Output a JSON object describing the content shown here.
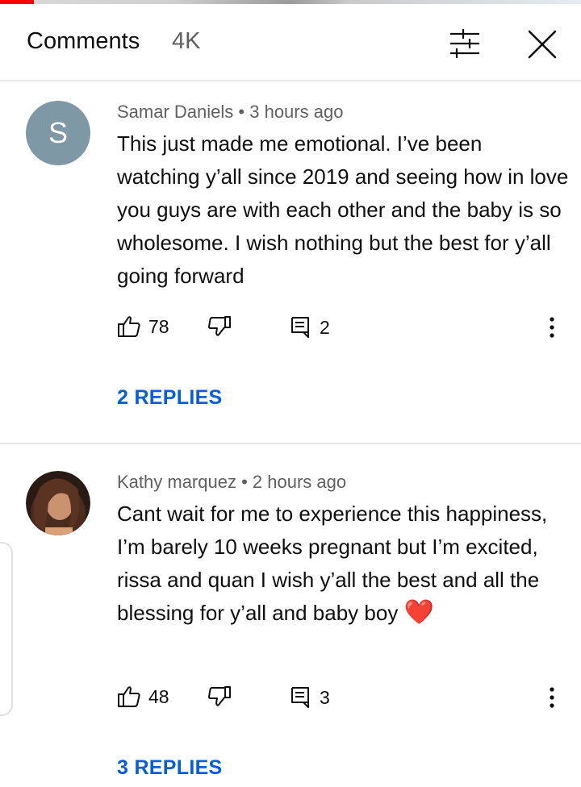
{
  "header": {
    "title": "Comments",
    "count": "4K"
  },
  "icons": {
    "filter": "filter-sliders-icon",
    "close": "close-icon",
    "like": "thumb-up-icon",
    "dislike": "thumb-down-icon",
    "reply": "reply-icon",
    "more": "more-vert-icon",
    "heart": "heart-emoji"
  },
  "colors": {
    "link": "#065fd4",
    "progress": "#ff0000",
    "avatar_s": "#7f98a6"
  },
  "comments": [
    {
      "avatar_letter": "S",
      "author": "Samar Daniels",
      "time": "3 hours ago",
      "text": "This just made me emotional. I’ve been watching y’all since 2019 and seeing how in love you guys are with each other and the baby is so wholesome. I wish nothing but the best for y’all going forward",
      "likes": "78",
      "replies_count": "2",
      "replies_label": "2 REPLIES"
    },
    {
      "author": "Kathy marquez",
      "time": "2 hours ago",
      "text": "Cant wait for me to experience this happiness, I’m barely 10 weeks pregnant but I’m excited, rissa and quan I wish y’all the best and all the blessing for y’all and baby boy",
      "emoji": "❤️",
      "likes": "48",
      "replies_count": "3",
      "replies_label": "3 REPLIES"
    }
  ]
}
